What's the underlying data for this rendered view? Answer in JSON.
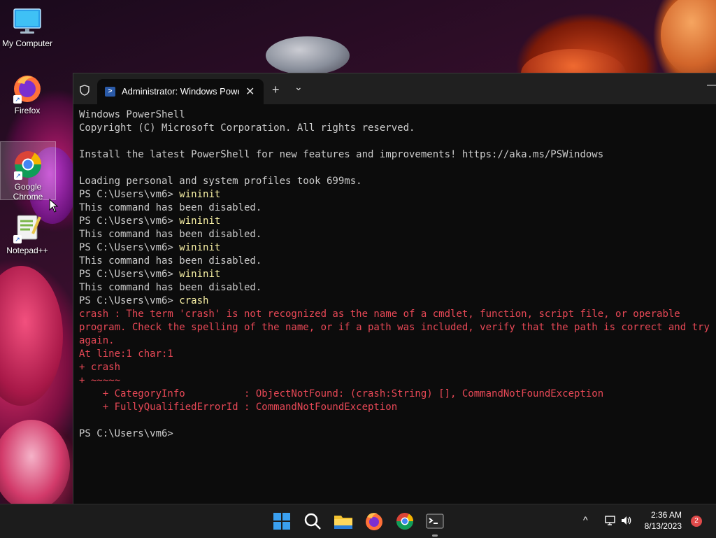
{
  "desktop": {
    "icons": [
      {
        "label": "My Computer"
      },
      {
        "label": "Firefox"
      },
      {
        "label": "Google Chrome"
      },
      {
        "label": "Notepad++"
      }
    ]
  },
  "terminal": {
    "tab_title": "Administrator: Windows Powe",
    "tab_close": "✕",
    "new_tab": "+",
    "dropdown": "⌄",
    "minimize": "—",
    "lines": [
      {
        "text": "Windows PowerShell"
      },
      {
        "text": "Copyright (C) Microsoft Corporation. All rights reserved."
      },
      {
        "text": ""
      },
      {
        "text": "Install the latest PowerShell for new features and improvements! https://aka.ms/PSWindows"
      },
      {
        "text": ""
      },
      {
        "text": "Loading personal and system profiles took 699ms."
      },
      {
        "prompt": "PS C:\\Users\\vm6> ",
        "cmd": "wininit"
      },
      {
        "text": "This command has been disabled."
      },
      {
        "prompt": "PS C:\\Users\\vm6> ",
        "cmd": "wininit"
      },
      {
        "text": "This command has been disabled."
      },
      {
        "prompt": "PS C:\\Users\\vm6> ",
        "cmd": "wininit"
      },
      {
        "text": "This command has been disabled."
      },
      {
        "prompt": "PS C:\\Users\\vm6> ",
        "cmd": "wininit"
      },
      {
        "text": "This command has been disabled."
      },
      {
        "prompt": "PS C:\\Users\\vm6> ",
        "cmd": "crash"
      },
      {
        "err": "crash : The term 'crash' is not recognized as the name of a cmdlet, function, script file, or operable"
      },
      {
        "err": "program. Check the spelling of the name, or if a path was included, verify that the path is correct and try"
      },
      {
        "err": "again."
      },
      {
        "err": "At line:1 char:1"
      },
      {
        "err": "+ crash"
      },
      {
        "err": "+ ~~~~~"
      },
      {
        "err": "    + CategoryInfo          : ObjectNotFound: (crash:String) [], CommandNotFoundException"
      },
      {
        "err": "    + FullyQualifiedErrorId : CommandNotFoundException"
      },
      {
        "text": ""
      },
      {
        "prompt": "PS C:\\Users\\vm6> ",
        "cmd": ""
      }
    ]
  },
  "taskbar": {
    "apps": [
      {
        "name": "start-icon"
      },
      {
        "name": "search-icon"
      },
      {
        "name": "file-explorer-icon"
      },
      {
        "name": "firefox-icon"
      },
      {
        "name": "chrome-icon"
      },
      {
        "name": "terminal-icon"
      }
    ],
    "tray_chevron": "^",
    "time": "2:36 AM",
    "date": "8/13/2023",
    "notification_count": "2"
  }
}
